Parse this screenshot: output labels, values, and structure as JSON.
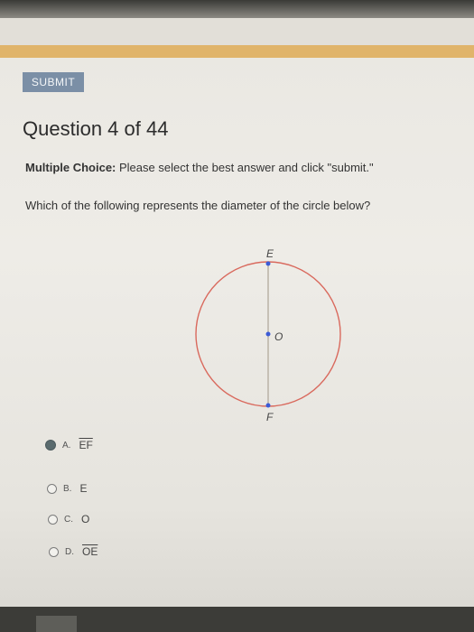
{
  "toolbar": {
    "submit_label": "SUBMIT"
  },
  "question": {
    "title": "Question 4 of 44",
    "type_label": "Multiple Choice:",
    "instruction": " Please select the best answer and click \"submit.\"",
    "prompt": "Which of the following represents the diameter of the circle below?"
  },
  "diagram": {
    "label_top": "E",
    "label_center": "O",
    "label_bottom": "F",
    "circle_color": "#d9695d",
    "point_color": "#3b5bd6"
  },
  "choices": [
    {
      "letter": "A.",
      "text": "EF",
      "overline": true,
      "selected": true
    },
    {
      "letter": "B.",
      "text": "E",
      "overline": false,
      "selected": false
    },
    {
      "letter": "C.",
      "text": "O",
      "overline": false,
      "selected": false
    },
    {
      "letter": "D.",
      "text": "OE",
      "overline": true,
      "selected": false
    }
  ]
}
